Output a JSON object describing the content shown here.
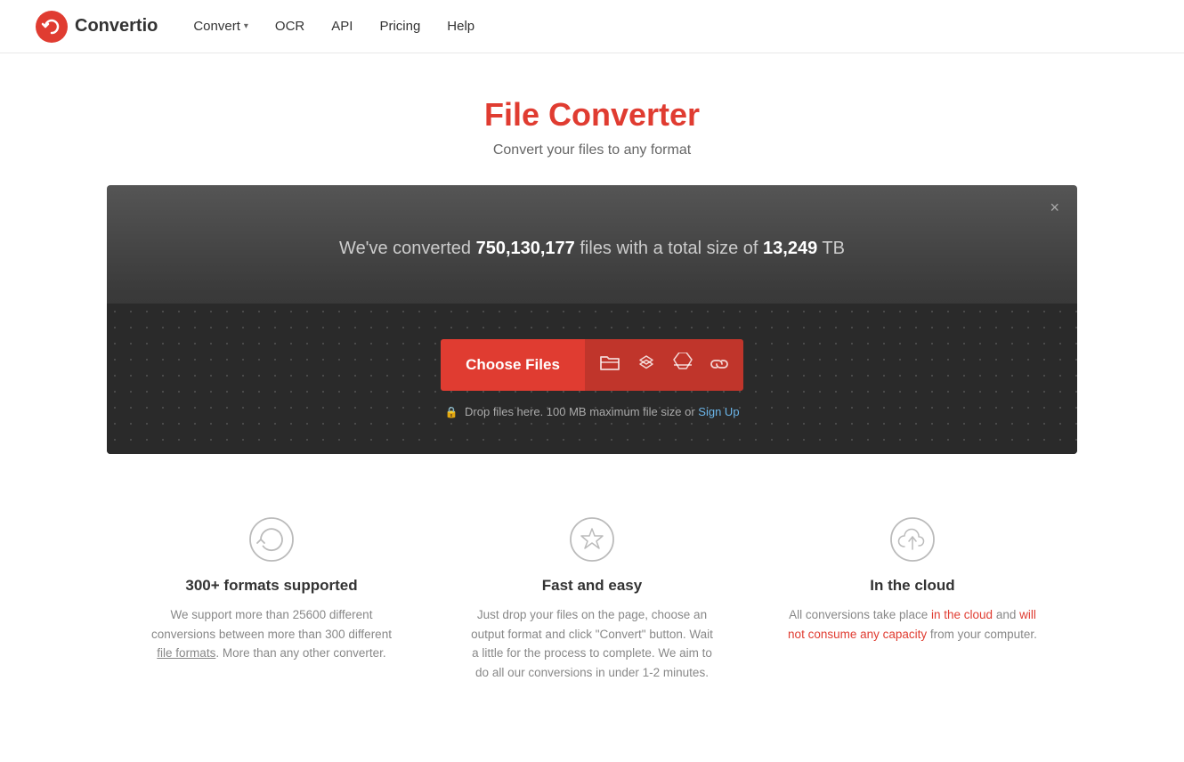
{
  "header": {
    "logo_text": "Convertio",
    "nav": [
      {
        "id": "convert",
        "label": "Convert",
        "has_dropdown": true
      },
      {
        "id": "ocr",
        "label": "OCR",
        "has_dropdown": false
      },
      {
        "id": "api",
        "label": "API",
        "has_dropdown": false
      },
      {
        "id": "pricing",
        "label": "Pricing",
        "has_dropdown": false
      },
      {
        "id": "help",
        "label": "Help",
        "has_dropdown": false
      }
    ]
  },
  "hero": {
    "title": "File Converter",
    "subtitle": "Convert your files to any format"
  },
  "converter": {
    "stats_prefix": "We've converted ",
    "stats_count": "750,130,177",
    "stats_middle": " files with a total size of ",
    "stats_size": "13,249",
    "stats_suffix": " TB",
    "choose_files_label": "Choose Files",
    "drop_text_prefix": "Drop files here. 100 MB maximum file size or ",
    "drop_text_link": "Sign Up",
    "close_label": "×"
  },
  "features": [
    {
      "id": "formats",
      "title": "300+ formats supported",
      "description": "We support more than 25600 different conversions between more than 300 different ",
      "link_text": "file formats",
      "description_suffix": ". More than any other converter.",
      "icon": "refresh"
    },
    {
      "id": "fast",
      "title": "Fast and easy",
      "description": "Just drop your files on the page, choose an output format and click \"Convert\" button. Wait a little for the process to complete. We aim to do all our conversions in under 1-2 minutes.",
      "icon": "star"
    },
    {
      "id": "cloud",
      "title": "In the cloud",
      "description_prefix": "All conversions take place ",
      "highlight1": "in the cloud",
      "description_middle": " and ",
      "highlight2": "will not consume any capacity",
      "description_suffix": " from your computer.",
      "icon": "cloud"
    }
  ],
  "colors": {
    "brand_red": "#e03c31",
    "nav_text": "#333",
    "hero_subtitle": "#666",
    "feature_desc": "#888"
  }
}
